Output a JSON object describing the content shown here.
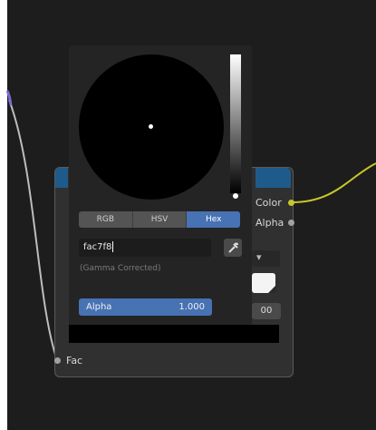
{
  "node": {
    "outputs": [
      {
        "label": "Color",
        "socket_color": "#c7c729"
      },
      {
        "label": "Alpha",
        "socket_color": "#a1a1a1"
      }
    ],
    "inputs": [
      {
        "label": "Fac",
        "socket_color": "#a1a1a1"
      }
    ],
    "field_value": "00"
  },
  "color_picker": {
    "modes": [
      "RGB",
      "HSV",
      "Hex"
    ],
    "active_mode": "Hex",
    "hex_value": "fac7f8",
    "gamma_note": "(Gamma Corrected)",
    "alpha_label": "Alpha",
    "alpha_value": "1.000"
  },
  "colors": {
    "accent": "#4772b3",
    "header": "#1f5b8a",
    "color_wire": "#c7c729",
    "fac_wire": "#bdbdbd",
    "left_wire_tip": "#7b6bd6",
    "swatch": "#f4f4f4"
  },
  "icons": [
    "eyedropper-icon",
    "chevron-down-icon"
  ]
}
